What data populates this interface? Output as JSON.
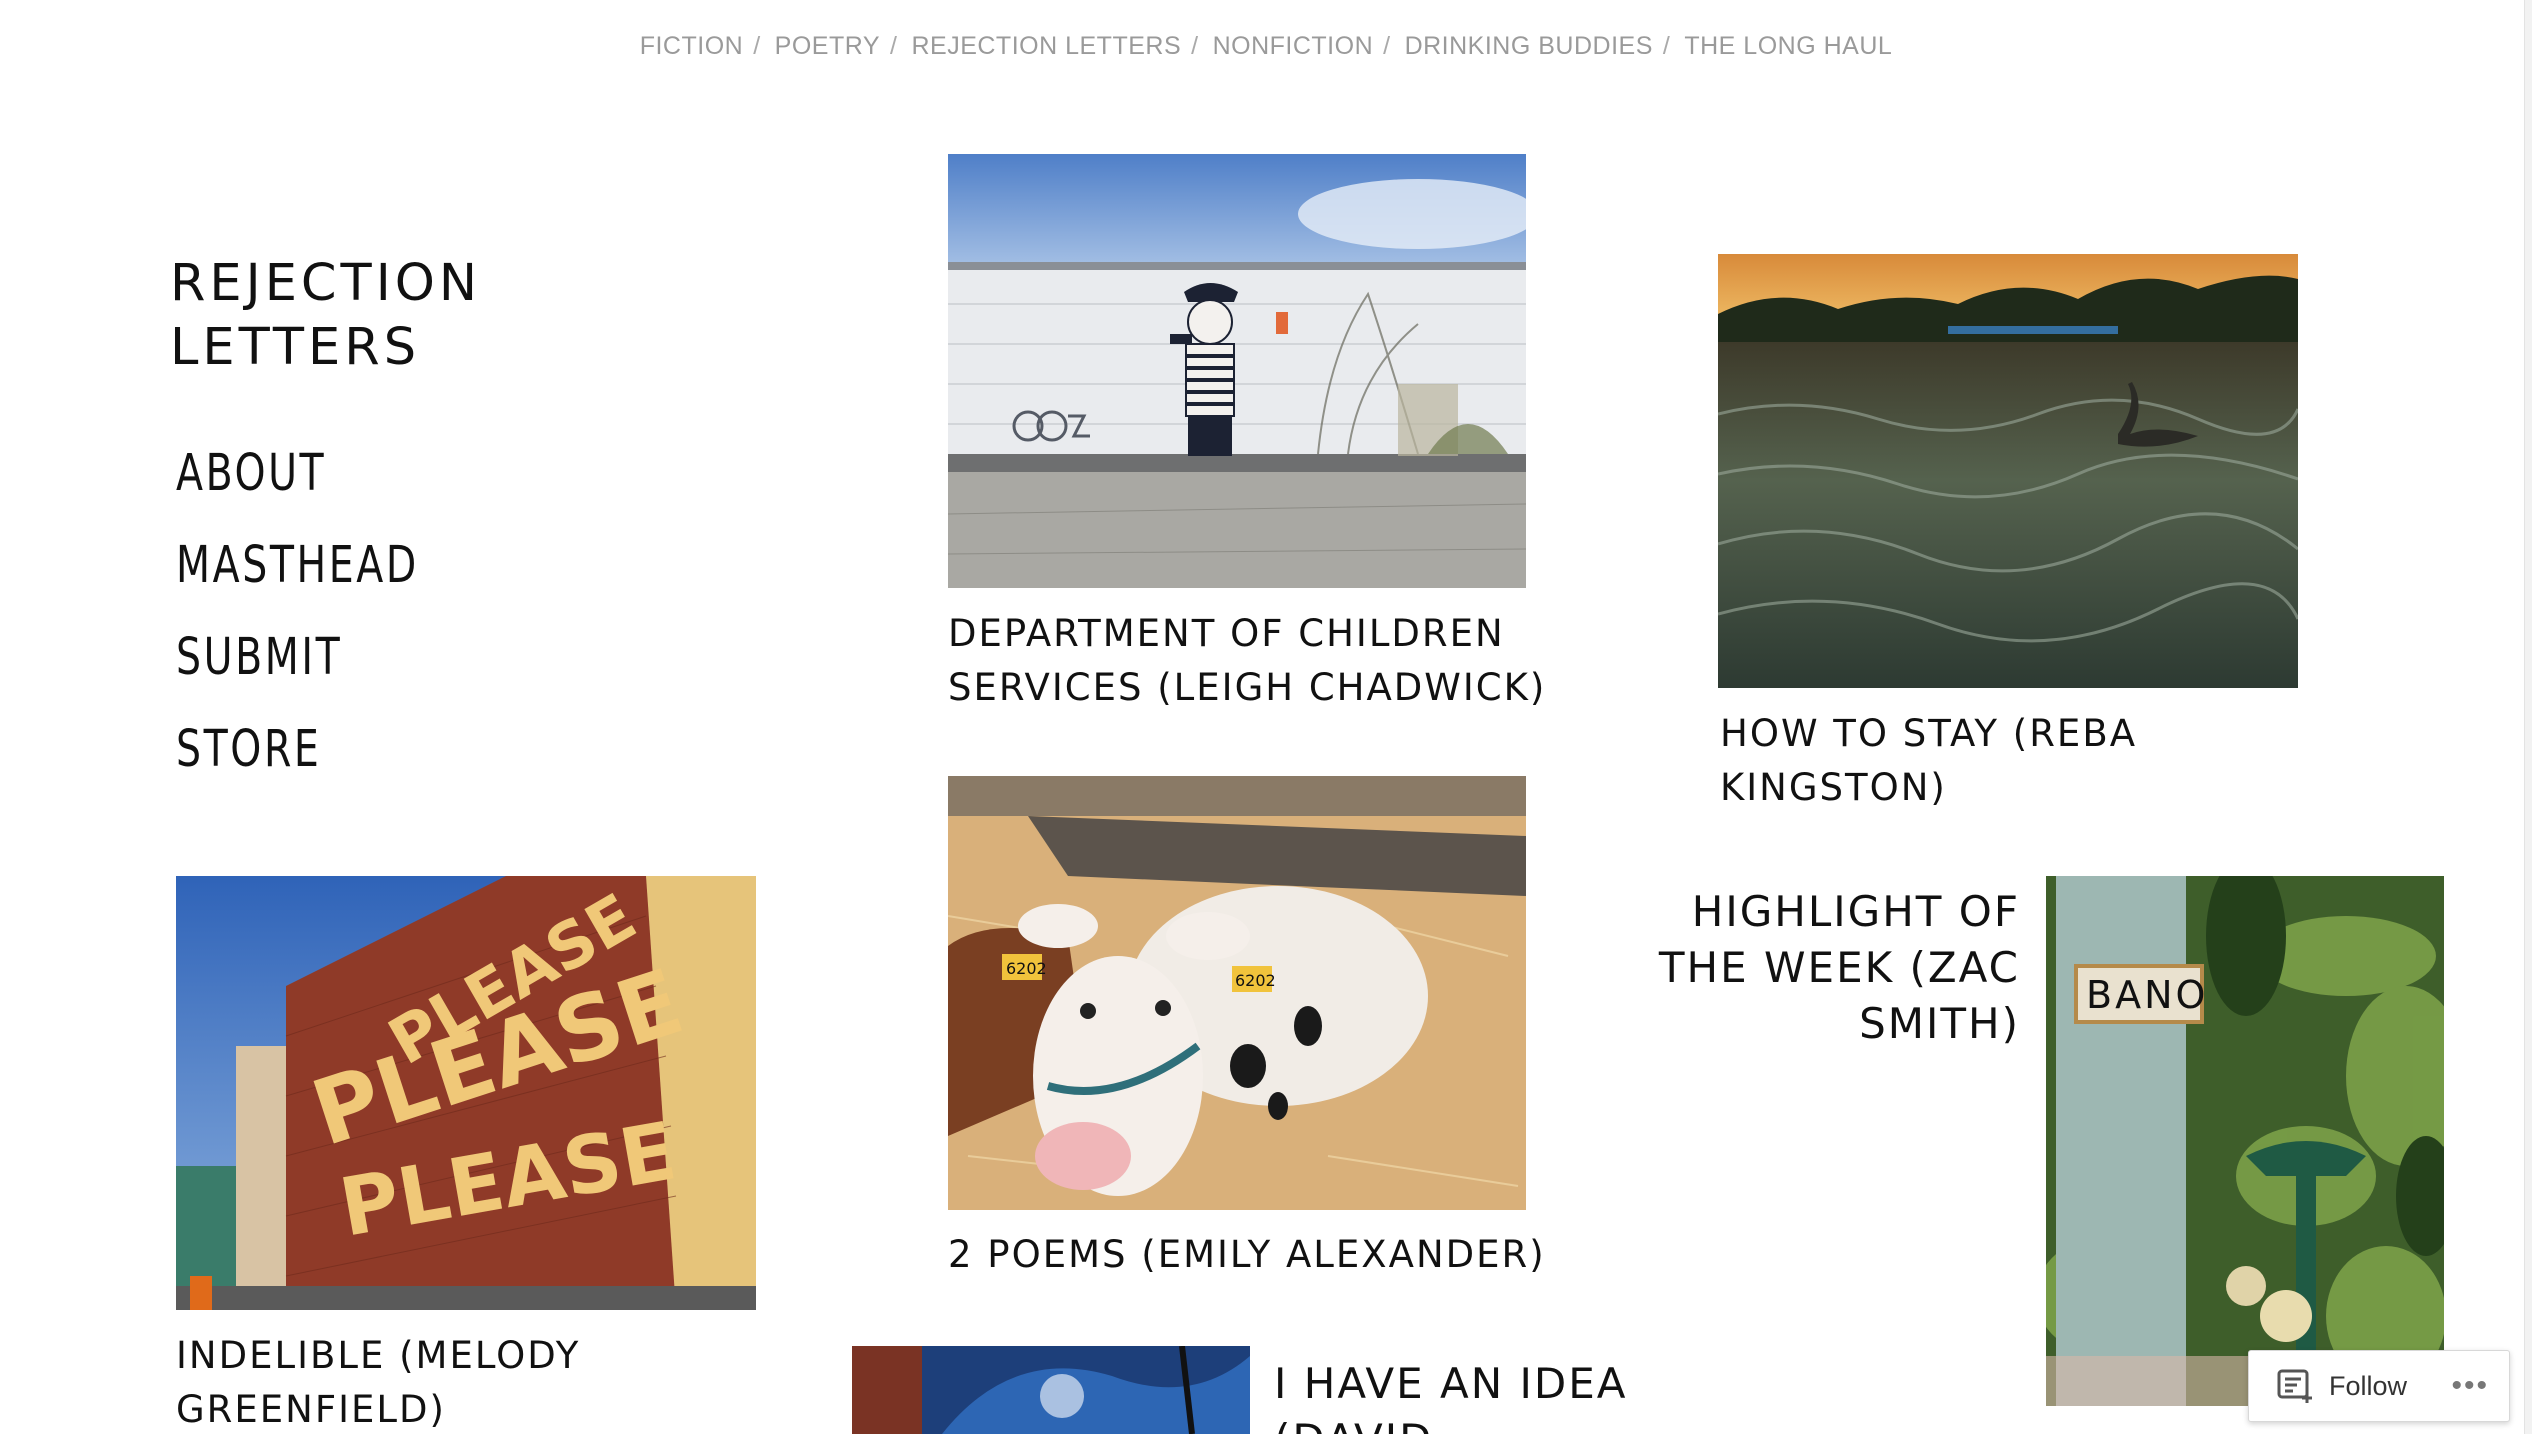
{
  "top_nav": {
    "items": [
      "FICTION",
      "POETRY",
      "REJECTION LETTERS",
      "NONFICTION",
      "DRINKING BUDDIES",
      "THE LONG HAUL"
    ],
    "separator": "/"
  },
  "site": {
    "title_line1": "REJECTION",
    "title_line2": "LETTERS"
  },
  "side_nav": {
    "about": "ABOUT",
    "masthead": "MASTHEAD",
    "submit": "SUBMIT",
    "store": "STORE"
  },
  "posts": {
    "dept_children": {
      "line1": "DEPARTMENT OF CHILDREN",
      "line2": "SERVICES (LEIGH CHADWICK)"
    },
    "how_to_stay": {
      "line1": "HOW TO STAY (REBA",
      "line2": "KINGSTON)"
    },
    "two_poems": {
      "line1": "2 POEMS (EMILY ALEXANDER)"
    },
    "highlight": {
      "line1": "HIGHLIGHT OF",
      "line2": "THE WEEK (ZAC",
      "line3": "SMITH)"
    },
    "indelible": {
      "line1": "INDELIBLE (MELODY",
      "line2": "GREENFIELD)"
    },
    "idea": {
      "line1": "I HAVE AN IDEA",
      "line2": "(DAVID"
    }
  },
  "image_text": {
    "mural_words": [
      "PLEASE",
      "PLEASE",
      "PLEASE"
    ],
    "cow_tag": "6202",
    "sign_text": "BANO"
  },
  "follow_widget": {
    "label": "Follow",
    "more": "•••"
  },
  "colors": {
    "nav_gray": "#9a9a9a",
    "text": "#111111"
  }
}
